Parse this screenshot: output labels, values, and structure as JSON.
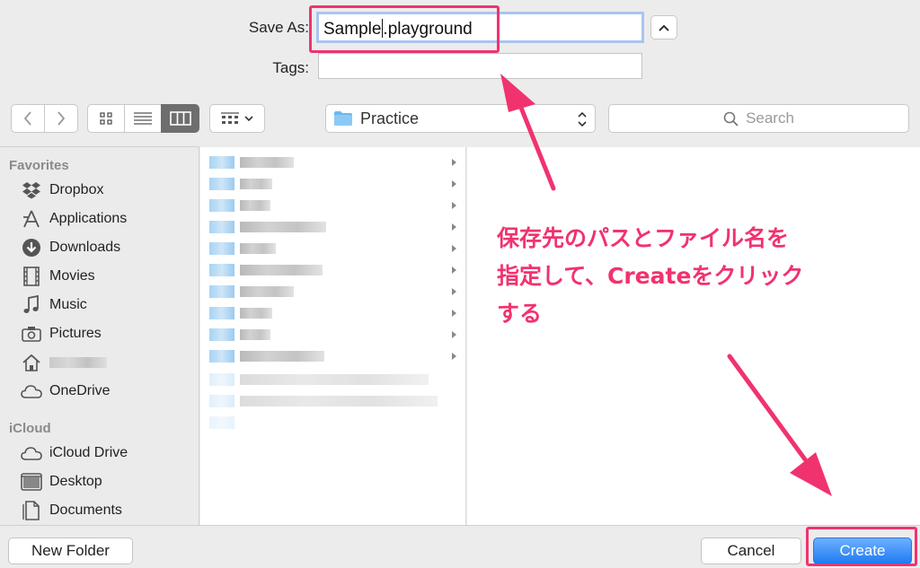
{
  "form": {
    "save_as_label": "Save As:",
    "filename_selected": "Sample",
    "filename_rest": "playground",
    "filename_dot": ".",
    "tags_label": "Tags:",
    "tags_value": ""
  },
  "toolbar": {
    "location": "Practice",
    "search_placeholder": "Search"
  },
  "sidebar": {
    "favorites_title": "Favorites",
    "favorites": [
      {
        "label": "Dropbox",
        "icon": "dropbox-icon"
      },
      {
        "label": "Applications",
        "icon": "applications-icon"
      },
      {
        "label": "Downloads",
        "icon": "downloads-icon"
      },
      {
        "label": "Movies",
        "icon": "movies-icon"
      },
      {
        "label": "Music",
        "icon": "music-icon"
      },
      {
        "label": "Pictures",
        "icon": "pictures-icon"
      },
      {
        "label": "",
        "icon": "home-icon"
      },
      {
        "label": "OneDrive",
        "icon": "onedrive-icon"
      }
    ],
    "icloud_title": "iCloud",
    "icloud": [
      {
        "label": "iCloud Drive",
        "icon": "icloud-drive-icon"
      },
      {
        "label": "Desktop",
        "icon": "desktop-icon"
      },
      {
        "label": "Documents",
        "icon": "documents-icon"
      }
    ]
  },
  "buttons": {
    "new_folder": "New Folder",
    "cancel": "Cancel",
    "create": "Create"
  },
  "annotation": {
    "line1": "保存先のパスとファイル名を",
    "line2": "指定して、Createをクリック",
    "line3": "する",
    "color": "#f0336f"
  }
}
